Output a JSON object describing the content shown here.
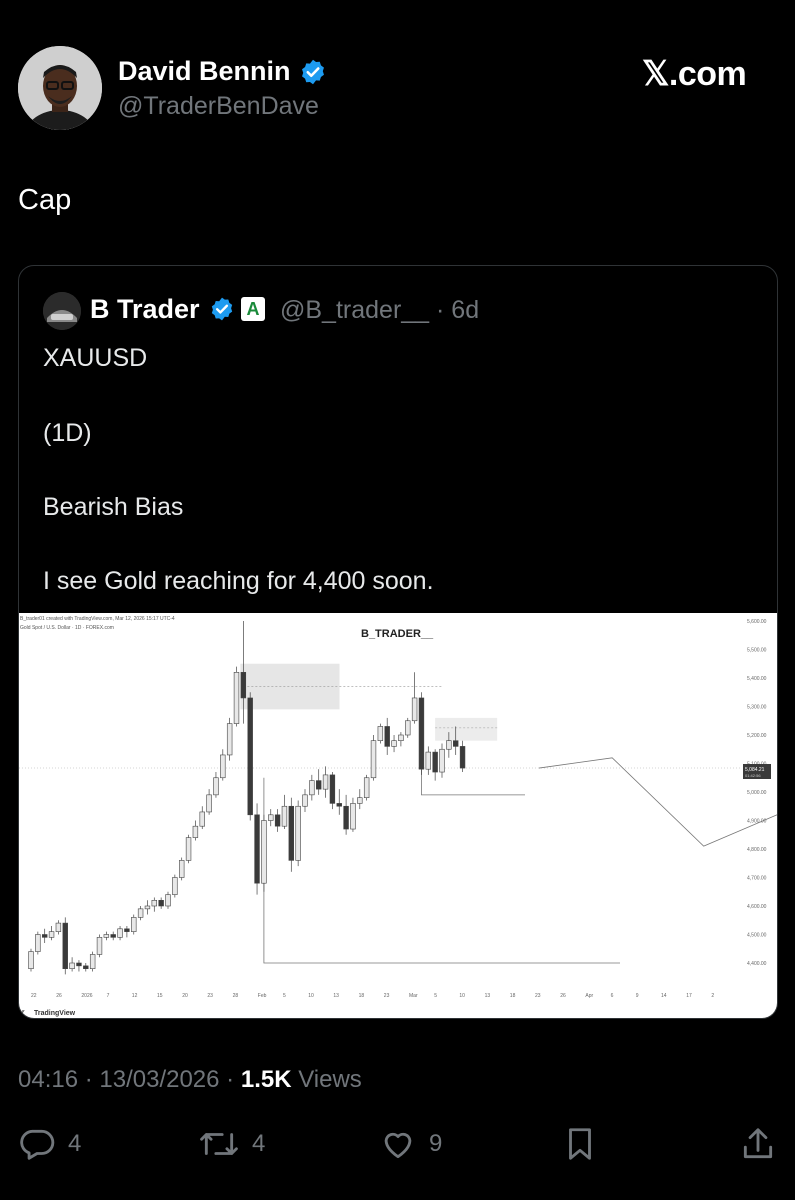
{
  "author": {
    "name": "David Bennin",
    "handle": "@TraderBenDave",
    "verified_color": "#1d9bf0"
  },
  "brand": "𝕏.com",
  "tweet_text": "Cap",
  "quote": {
    "name": "B Trader",
    "handle": "@B_trader__",
    "age": "· 6d",
    "badge_letter": "A",
    "lines": [
      "XAUUSD",
      "(1D)",
      "Bearish Bias",
      "I see Gold reaching for 4,400 soon."
    ]
  },
  "chart_header": {
    "title": "B_TRADER__",
    "small_top": "B_trader01 created with TradingView.com, Mar 12, 2026 15:17 UTC-4",
    "small_sub": "Gold Spot / U.S. Dollar · 1D · FOREX.com",
    "footer": "TradingView",
    "price_badge": "5,084.21",
    "price_badge_sub": "01:42:56"
  },
  "chart_data": {
    "type": "candlestick",
    "title": "B_TRADER__",
    "ylim": [
      4380,
      5600
    ],
    "y_ticks": [
      5600,
      5500,
      5400,
      5300,
      5200,
      5100,
      5000,
      4900,
      4800,
      4700,
      4600,
      4500,
      4400
    ],
    "y_tick_labels": [
      "5,600.00",
      "5,500.00",
      "5,400.00",
      "5,300.00",
      "5,200.00",
      "5,100.00",
      "5,000.00",
      "4,900.00",
      "4,800.00",
      "4,700.00",
      "4,600.00",
      "4,500.00",
      "4,400.00"
    ],
    "x_tick_labels": [
      "22",
      "26",
      "2026",
      "7",
      "12",
      "15",
      "20",
      "23",
      "28",
      "Feb",
      "5",
      "10",
      "13",
      "18",
      "23",
      "Mar",
      "5",
      "10",
      "13",
      "18",
      "23",
      "26",
      "Apr",
      "6",
      "9",
      "14",
      "17",
      "2"
    ],
    "candles": [
      [
        4380,
        4440,
        4370,
        4450
      ],
      [
        4440,
        4500,
        4430,
        4510
      ],
      [
        4500,
        4490,
        4470,
        4520
      ],
      [
        4490,
        4510,
        4480,
        4530
      ],
      [
        4510,
        4540,
        4500,
        4550
      ],
      [
        4540,
        4380,
        4360,
        4560
      ],
      [
        4380,
        4400,
        4370,
        4420
      ],
      [
        4400,
        4390,
        4370,
        4410
      ],
      [
        4390,
        4380,
        4370,
        4400
      ],
      [
        4380,
        4430,
        4370,
        4440
      ],
      [
        4430,
        4490,
        4420,
        4500
      ],
      [
        4490,
        4500,
        4480,
        4510
      ],
      [
        4500,
        4490,
        4480,
        4510
      ],
      [
        4490,
        4520,
        4480,
        4530
      ],
      [
        4520,
        4510,
        4490,
        4530
      ],
      [
        4510,
        4560,
        4500,
        4570
      ],
      [
        4560,
        4590,
        4550,
        4600
      ],
      [
        4590,
        4600,
        4570,
        4620
      ],
      [
        4600,
        4620,
        4580,
        4630
      ],
      [
        4620,
        4600,
        4590,
        4630
      ],
      [
        4600,
        4640,
        4590,
        4650
      ],
      [
        4640,
        4700,
        4630,
        4710
      ],
      [
        4700,
        4760,
        4690,
        4770
      ],
      [
        4760,
        4840,
        4750,
        4850
      ],
      [
        4840,
        4880,
        4830,
        4900
      ],
      [
        4880,
        4930,
        4870,
        4950
      ],
      [
        4930,
        4990,
        4920,
        5010
      ],
      [
        4990,
        5050,
        4980,
        5070
      ],
      [
        5050,
        5130,
        5040,
        5150
      ],
      [
        5130,
        5240,
        5110,
        5260
      ],
      [
        5240,
        5420,
        5230,
        5440
      ],
      [
        5420,
        5330,
        5240,
        5600
      ],
      [
        5330,
        4920,
        4900,
        5350
      ],
      [
        4920,
        4680,
        4640,
        4960
      ],
      [
        4680,
        4900,
        4650,
        4920
      ],
      [
        4900,
        4920,
        4880,
        4940
      ],
      [
        4920,
        4880,
        4860,
        4940
      ],
      [
        4880,
        4950,
        4870,
        4990
      ],
      [
        4950,
        4760,
        4720,
        4980
      ],
      [
        4760,
        4950,
        4740,
        4970
      ],
      [
        4950,
        4990,
        4930,
        5010
      ],
      [
        4990,
        5040,
        4970,
        5060
      ],
      [
        5040,
        5010,
        4990,
        5080
      ],
      [
        5010,
        5060,
        4980,
        5090
      ],
      [
        5060,
        4960,
        4940,
        5070
      ],
      [
        4960,
        4950,
        4920,
        5010
      ],
      [
        4950,
        4870,
        4850,
        4990
      ],
      [
        4870,
        4960,
        4860,
        4980
      ],
      [
        4960,
        4980,
        4940,
        5010
      ],
      [
        4980,
        5050,
        4970,
        5060
      ],
      [
        5050,
        5180,
        5040,
        5200
      ],
      [
        5180,
        5230,
        5170,
        5240
      ],
      [
        5230,
        5160,
        5130,
        5260
      ],
      [
        5160,
        5180,
        5140,
        5200
      ],
      [
        5180,
        5200,
        5160,
        5210
      ],
      [
        5200,
        5250,
        5190,
        5260
      ],
      [
        5250,
        5330,
        5240,
        5420
      ],
      [
        5330,
        5080,
        5060,
        5350
      ],
      [
        5080,
        5140,
        5060,
        5160
      ],
      [
        5140,
        5070,
        5040,
        5150
      ],
      [
        5070,
        5150,
        5050,
        5170
      ],
      [
        5150,
        5180,
        5120,
        5210
      ],
      [
        5180,
        5160,
        5130,
        5230
      ],
      [
        5160,
        5084,
        5070,
        5180
      ]
    ],
    "projection": [
      [
        5130,
        5084
      ],
      [
        5150,
        5120
      ],
      [
        5175,
        4810
      ],
      [
        5195,
        4920
      ],
      [
        5223,
        4400
      ]
    ],
    "supply_zone": [
      5290,
      5450
    ],
    "minor_zone": [
      5180,
      5260
    ],
    "box_level": 4990,
    "target_level": 4400,
    "current_price": 5084.21
  },
  "timestamp_line": {
    "datetime": "04:16 · 13/03/2026 ·",
    "views_count": "1.5K",
    "views_label": "Views"
  },
  "actions": {
    "replies": "4",
    "reposts": "4",
    "likes": "9"
  }
}
